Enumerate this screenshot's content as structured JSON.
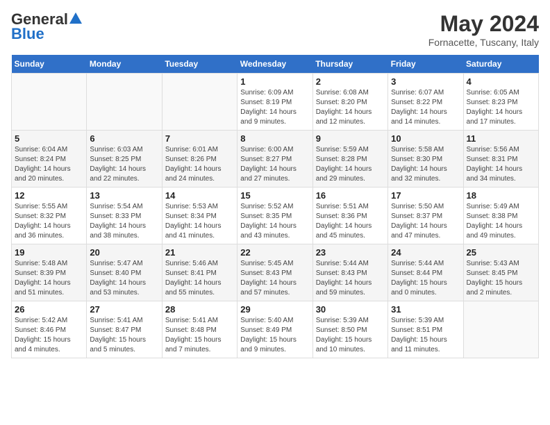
{
  "logo": {
    "line1": "General",
    "line2": "Blue"
  },
  "title": "May 2024",
  "subtitle": "Fornacette, Tuscany, Italy",
  "days_header": [
    "Sunday",
    "Monday",
    "Tuesday",
    "Wednesday",
    "Thursday",
    "Friday",
    "Saturday"
  ],
  "weeks": [
    [
      {
        "num": "",
        "info": ""
      },
      {
        "num": "",
        "info": ""
      },
      {
        "num": "",
        "info": ""
      },
      {
        "num": "1",
        "info": "Sunrise: 6:09 AM\nSunset: 8:19 PM\nDaylight: 14 hours\nand 9 minutes."
      },
      {
        "num": "2",
        "info": "Sunrise: 6:08 AM\nSunset: 8:20 PM\nDaylight: 14 hours\nand 12 minutes."
      },
      {
        "num": "3",
        "info": "Sunrise: 6:07 AM\nSunset: 8:22 PM\nDaylight: 14 hours\nand 14 minutes."
      },
      {
        "num": "4",
        "info": "Sunrise: 6:05 AM\nSunset: 8:23 PM\nDaylight: 14 hours\nand 17 minutes."
      }
    ],
    [
      {
        "num": "5",
        "info": "Sunrise: 6:04 AM\nSunset: 8:24 PM\nDaylight: 14 hours\nand 20 minutes."
      },
      {
        "num": "6",
        "info": "Sunrise: 6:03 AM\nSunset: 8:25 PM\nDaylight: 14 hours\nand 22 minutes."
      },
      {
        "num": "7",
        "info": "Sunrise: 6:01 AM\nSunset: 8:26 PM\nDaylight: 14 hours\nand 24 minutes."
      },
      {
        "num": "8",
        "info": "Sunrise: 6:00 AM\nSunset: 8:27 PM\nDaylight: 14 hours\nand 27 minutes."
      },
      {
        "num": "9",
        "info": "Sunrise: 5:59 AM\nSunset: 8:28 PM\nDaylight: 14 hours\nand 29 minutes."
      },
      {
        "num": "10",
        "info": "Sunrise: 5:58 AM\nSunset: 8:30 PM\nDaylight: 14 hours\nand 32 minutes."
      },
      {
        "num": "11",
        "info": "Sunrise: 5:56 AM\nSunset: 8:31 PM\nDaylight: 14 hours\nand 34 minutes."
      }
    ],
    [
      {
        "num": "12",
        "info": "Sunrise: 5:55 AM\nSunset: 8:32 PM\nDaylight: 14 hours\nand 36 minutes."
      },
      {
        "num": "13",
        "info": "Sunrise: 5:54 AM\nSunset: 8:33 PM\nDaylight: 14 hours\nand 38 minutes."
      },
      {
        "num": "14",
        "info": "Sunrise: 5:53 AM\nSunset: 8:34 PM\nDaylight: 14 hours\nand 41 minutes."
      },
      {
        "num": "15",
        "info": "Sunrise: 5:52 AM\nSunset: 8:35 PM\nDaylight: 14 hours\nand 43 minutes."
      },
      {
        "num": "16",
        "info": "Sunrise: 5:51 AM\nSunset: 8:36 PM\nDaylight: 14 hours\nand 45 minutes."
      },
      {
        "num": "17",
        "info": "Sunrise: 5:50 AM\nSunset: 8:37 PM\nDaylight: 14 hours\nand 47 minutes."
      },
      {
        "num": "18",
        "info": "Sunrise: 5:49 AM\nSunset: 8:38 PM\nDaylight: 14 hours\nand 49 minutes."
      }
    ],
    [
      {
        "num": "19",
        "info": "Sunrise: 5:48 AM\nSunset: 8:39 PM\nDaylight: 14 hours\nand 51 minutes."
      },
      {
        "num": "20",
        "info": "Sunrise: 5:47 AM\nSunset: 8:40 PM\nDaylight: 14 hours\nand 53 minutes."
      },
      {
        "num": "21",
        "info": "Sunrise: 5:46 AM\nSunset: 8:41 PM\nDaylight: 14 hours\nand 55 minutes."
      },
      {
        "num": "22",
        "info": "Sunrise: 5:45 AM\nSunset: 8:43 PM\nDaylight: 14 hours\nand 57 minutes."
      },
      {
        "num": "23",
        "info": "Sunrise: 5:44 AM\nSunset: 8:43 PM\nDaylight: 14 hours\nand 59 minutes."
      },
      {
        "num": "24",
        "info": "Sunrise: 5:44 AM\nSunset: 8:44 PM\nDaylight: 15 hours\nand 0 minutes."
      },
      {
        "num": "25",
        "info": "Sunrise: 5:43 AM\nSunset: 8:45 PM\nDaylight: 15 hours\nand 2 minutes."
      }
    ],
    [
      {
        "num": "26",
        "info": "Sunrise: 5:42 AM\nSunset: 8:46 PM\nDaylight: 15 hours\nand 4 minutes."
      },
      {
        "num": "27",
        "info": "Sunrise: 5:41 AM\nSunset: 8:47 PM\nDaylight: 15 hours\nand 5 minutes."
      },
      {
        "num": "28",
        "info": "Sunrise: 5:41 AM\nSunset: 8:48 PM\nDaylight: 15 hours\nand 7 minutes."
      },
      {
        "num": "29",
        "info": "Sunrise: 5:40 AM\nSunset: 8:49 PM\nDaylight: 15 hours\nand 9 minutes."
      },
      {
        "num": "30",
        "info": "Sunrise: 5:39 AM\nSunset: 8:50 PM\nDaylight: 15 hours\nand 10 minutes."
      },
      {
        "num": "31",
        "info": "Sunrise: 5:39 AM\nSunset: 8:51 PM\nDaylight: 15 hours\nand 11 minutes."
      },
      {
        "num": "",
        "info": ""
      }
    ]
  ]
}
